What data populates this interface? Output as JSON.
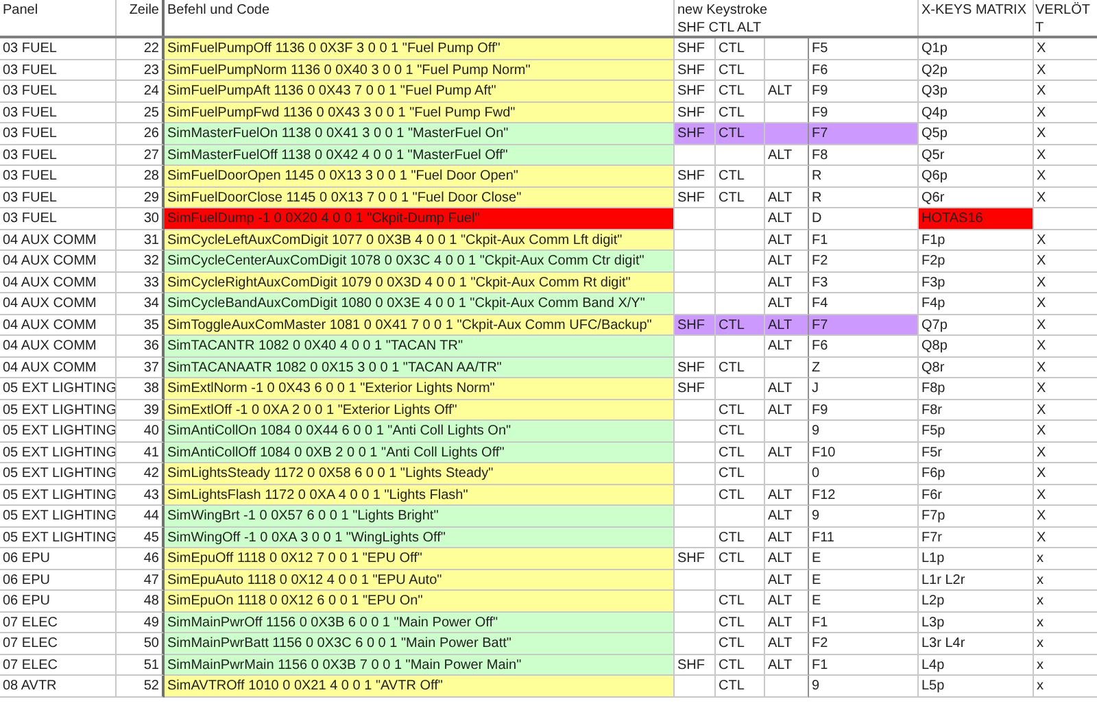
{
  "columns": {
    "panel": "Panel",
    "line": "Zeile",
    "code": "Befehl und Code",
    "keystroke": [
      "new Keystroke",
      "SHF CTL ALT"
    ],
    "matrix": "X-KEYS MATRIX",
    "soldered": [
      "VERLÖT",
      "T"
    ]
  },
  "rows": [
    {
      "panel": "03 FUEL",
      "line": "22",
      "code": "SimFuelPumpOff 1136 0 0X3F 3 0 0 1 \"Fuel Pump Off\"",
      "color": "#ffff99",
      "shf": "SHF",
      "ctl": "CTL",
      "key": "F5",
      "key_marked": false,
      "matrix": "Q1p",
      "matrix_marked": false,
      "soldered": "X"
    },
    {
      "panel": "03 FUEL",
      "line": "23",
      "code": "SimFuelPumpNorm 1136 0 0X40 3 0 0 1 \"Fuel Pump Norm\"",
      "color": "#ffff99",
      "shf": "SHF",
      "ctl": "CTL",
      "key": "F6",
      "key_marked": false,
      "matrix": "Q2p",
      "matrix_marked": false,
      "soldered": "X"
    },
    {
      "panel": "03 FUEL",
      "line": "24",
      "code": "SimFuelPumpAft 1136 0 0X43 7 0 0 1 \"Fuel Pump Aft\"",
      "color": "#ffff99",
      "shf": "SHF",
      "ctl": "CTL",
      "alt": "ALT",
      "key": "F9",
      "key_marked": false,
      "matrix": "Q3p",
      "matrix_marked": false,
      "soldered": "X"
    },
    {
      "panel": "03 FUEL",
      "line": "25",
      "code": "SimFuelPumpFwd 1136 0 0X43 3 0 0 1 \"Fuel Pump Fwd\"",
      "color": "#ffff99",
      "shf": "SHF",
      "ctl": "CTL",
      "key": "F9",
      "key_marked": false,
      "matrix": "Q4p",
      "matrix_marked": false,
      "soldered": "X"
    },
    {
      "panel": "03 FUEL",
      "line": "26",
      "code": "SimMasterFuelOn 1138 0 0X41 3 0 0 1 \"MasterFuel On\"",
      "color": "#ccffcc",
      "shf": "SHF",
      "ctl": "CTL",
      "key": "F7",
      "key_marked": true,
      "matrix": "Q5p",
      "matrix_marked": false,
      "soldered": "X"
    },
    {
      "panel": "03 FUEL",
      "line": "27",
      "code": "SimMasterFuelOff 1138 0 0X42 4 0 0 1 \"MasterFuel Off\"",
      "color": "#ccffcc",
      "alt": "ALT",
      "key": "F8",
      "key_marked": false,
      "matrix": "Q5r",
      "matrix_marked": false,
      "soldered": "X"
    },
    {
      "panel": "03 FUEL",
      "line": "28",
      "code": "SimFuelDoorOpen 1145 0 0X13 3 0 0 1 \"Fuel Door Open\"",
      "color": "#ffff99",
      "shf": "SHF",
      "ctl": "CTL",
      "key": "R",
      "key_marked": false,
      "matrix": "Q6p",
      "matrix_marked": false,
      "soldered": "X"
    },
    {
      "panel": "03 FUEL",
      "line": "29",
      "code": "SimFuelDoorClose 1145 0 0X13 7 0 0 1 \"Fuel Door Close\"",
      "color": "#ffff99",
      "shf": "SHF",
      "ctl": "CTL",
      "alt": "ALT",
      "key": "R",
      "key_marked": false,
      "matrix": "Q6r",
      "matrix_marked": false,
      "soldered": "X"
    },
    {
      "panel": "03 FUEL",
      "line": "30",
      "code": "SimFuelDump -1 0 0X20 4 0 0 1 \"Ckpit-Dump Fuel\"",
      "color": "#ff0000",
      "alt": "ALT",
      "key": "D",
      "key_marked": false,
      "matrix": "HOTAS16",
      "matrix_marked": true
    },
    {
      "panel": "04 AUX COMM",
      "line": "31",
      "code": "SimCycleLeftAuxComDigit 1077 0 0X3B 4 0 0 1 \"Ckpit-Aux Comm Lft digit\"",
      "color": "#ffff99",
      "alt": "ALT",
      "key": "F1",
      "key_marked": false,
      "matrix": "F1p",
      "matrix_marked": false,
      "soldered": "X"
    },
    {
      "panel": "04 AUX COMM",
      "line": "32",
      "code": "SimCycleCenterAuxComDigit 1078 0 0X3C 4 0 0 1 \"Ckpit-Aux Comm Ctr digit\"",
      "color": "#ccffcc",
      "alt": "ALT",
      "key": "F2",
      "key_marked": false,
      "matrix": "F2p",
      "matrix_marked": false,
      "soldered": "X"
    },
    {
      "panel": "04 AUX COMM",
      "line": "33",
      "code": "SimCycleRightAuxComDigit 1079 0 0X3D 4 0 0 1 \"Ckpit-Aux Comm Rt digit\"",
      "color": "#ffff99",
      "alt": "ALT",
      "key": "F3",
      "key_marked": false,
      "matrix": "F3p",
      "matrix_marked": false,
      "soldered": "X"
    },
    {
      "panel": "04 AUX COMM",
      "line": "34",
      "code": "SimCycleBandAuxComDigit 1080 0 0X3E 4 0 0 1 \"Ckpit-Aux Comm Band X/Y\"",
      "color": "#ccffcc",
      "alt": "ALT",
      "key": "F4",
      "key_marked": false,
      "matrix": "F4p",
      "matrix_marked": false,
      "soldered": "X"
    },
    {
      "panel": "04 AUX COMM",
      "line": "35",
      "code": "SimToggleAuxComMaster 1081 0 0X41 7 0 0 1 \"Ckpit-Aux Comm UFC/Backup\"",
      "color": "#ffff99",
      "shf": "SHF",
      "ctl": "CTL",
      "alt": "ALT",
      "key": "F7",
      "key_marked": true,
      "matrix": "Q7p",
      "matrix_marked": false,
      "soldered": "X"
    },
    {
      "panel": "04 AUX COMM",
      "line": "36",
      "code": "SimTACANTR 1082 0 0X40 4 0 0 1 \"TACAN TR\"",
      "color": "#ccffcc",
      "alt": "ALT",
      "key": "F6",
      "key_marked": false,
      "matrix": "Q8p",
      "matrix_marked": false,
      "soldered": "X"
    },
    {
      "panel": "04 AUX COMM",
      "line": "37",
      "code": "SimTACANAATR 1082 0 0X15 3 0 0 1 \"TACAN AA/TR\"",
      "color": "#ccffcc",
      "shf": "SHF",
      "ctl": "CTL",
      "key": "Z",
      "key_marked": false,
      "matrix": "Q8r",
      "matrix_marked": false,
      "soldered": "X"
    },
    {
      "panel": "05 EXT LIGHTING",
      "line": "38",
      "code": "SimExtlNorm -1 0 0X43 6 0 0 1 \"Exterior Lights Norm\"",
      "color": "#ffff99",
      "shf": "SHF",
      "alt": "ALT",
      "key": "J",
      "key_marked": false,
      "matrix": "F8p",
      "matrix_marked": false,
      "soldered": "X"
    },
    {
      "panel": "05 EXT LIGHTING",
      "line": "39",
      "code": "SimExtlOff -1 0 0XA 2 0 0 1 \"Exterior Lights Off\"",
      "color": "#ffff99",
      "ctl": "CTL",
      "alt": "ALT",
      "key": "F9",
      "key_marked": false,
      "matrix": "F8r",
      "matrix_marked": false,
      "soldered": "X"
    },
    {
      "panel": "05 EXT LIGHTING",
      "line": "40",
      "code": "SimAntiCollOn 1084 0 0X44 6 0 0 1 \"Anti Coll Lights On\"",
      "color": "#ccffcc",
      "ctl": "CTL",
      "key": "9",
      "key_marked": false,
      "matrix": "F5p",
      "matrix_marked": false,
      "soldered": "X"
    },
    {
      "panel": "05 EXT LIGHTING",
      "line": "41",
      "code": "SimAntiCollOff 1084 0 0XB 2 0 0 1 \"Anti Coll Lights Off\"",
      "color": "#ccffcc",
      "ctl": "CTL",
      "alt": "ALT",
      "key": "F10",
      "key_marked": false,
      "matrix": "F5r",
      "matrix_marked": false,
      "soldered": "X"
    },
    {
      "panel": "05 EXT LIGHTING",
      "line": "42",
      "code": "SimLightsSteady 1172 0 0X58 6 0 0 1 \"Lights Steady\"",
      "color": "#ffff99",
      "ctl": "CTL",
      "key": "0",
      "key_marked": false,
      "matrix": "F6p",
      "matrix_marked": false,
      "soldered": "X"
    },
    {
      "panel": "05 EXT LIGHTING",
      "line": "43",
      "code": "SimLightsFlash 1172 0 0XA 4 0 0 1 \"Lights Flash\"",
      "color": "#ffff99",
      "ctl": "CTL",
      "alt": "ALT",
      "key": "F12",
      "key_marked": false,
      "matrix": "F6r",
      "matrix_marked": false,
      "soldered": "X"
    },
    {
      "panel": "05 EXT LIGHTING",
      "line": "44",
      "code": "SimWingBrt -1 0 0X57 6 0 0 1 \"Lights Bright\"",
      "color": "#ccffcc",
      "alt": "ALT",
      "key": "9",
      "key_marked": false,
      "matrix": "F7p",
      "matrix_marked": false,
      "soldered": "X"
    },
    {
      "panel": "05 EXT LIGHTING",
      "line": "45",
      "code": "SimWingOff -1 0 0XA 3 0 0 1 \"WingLights Off\"",
      "color": "#ccffcc",
      "ctl": "CTL",
      "alt": "ALT",
      "key": "F11",
      "key_marked": false,
      "matrix": "F7r",
      "matrix_marked": false,
      "soldered": "X"
    },
    {
      "panel": "06 EPU",
      "line": "46",
      "code": "SimEpuOff 1118 0 0X12 7 0 0 1 \"EPU Off\"",
      "color": "#ffff99",
      "shf": "SHF",
      "ctl": "CTL",
      "alt": "ALT",
      "key": "E",
      "key_marked": false,
      "matrix": "L1p",
      "matrix_marked": false,
      "soldered": "x"
    },
    {
      "panel": "06 EPU",
      "line": "47",
      "code": "SimEpuAuto 1118 0 0X12 4 0 0 1 \"EPU Auto\"",
      "color": "#ffff99",
      "alt": "ALT",
      "key": "E",
      "key_marked": false,
      "matrix": "L1r L2r",
      "matrix_marked": false,
      "soldered": "x"
    },
    {
      "panel": "06 EPU",
      "line": "48",
      "code": "SimEpuOn 1118 0 0X12 6 0 0 1 \"EPU On\"",
      "color": "#ffff99",
      "ctl": "CTL",
      "alt": "ALT",
      "key": "E",
      "key_marked": false,
      "matrix": "L2p",
      "matrix_marked": false,
      "soldered": "x"
    },
    {
      "panel": "07 ELEC",
      "line": "49",
      "code": "SimMainPwrOff 1156 0 0X3B 6 0 0 1 \"Main Power Off\"",
      "color": "#ccffcc",
      "ctl": "CTL",
      "alt": "ALT",
      "key": "F1",
      "key_marked": false,
      "matrix": "L3p",
      "matrix_marked": false,
      "soldered": "x"
    },
    {
      "panel": "07 ELEC",
      "line": "50",
      "code": "SimMainPwrBatt 1156 0 0X3C 6 0 0 1 \"Main Power Batt\"",
      "color": "#ccffcc",
      "ctl": "CTL",
      "alt": "ALT",
      "key": "F2",
      "key_marked": false,
      "matrix": "L3r L4r",
      "matrix_marked": false,
      "soldered": "x"
    },
    {
      "panel": "07 ELEC",
      "line": "51",
      "code": "SimMainPwrMain 1156 0 0X3B 7 0 0 1 \"Main Power Main\"",
      "color": "#ccffcc",
      "shf": "SHF",
      "ctl": "CTL",
      "alt": "ALT",
      "key": "F1",
      "key_marked": false,
      "matrix": "L4p",
      "matrix_marked": false,
      "soldered": "x"
    },
    {
      "panel": "08 AVTR",
      "line": "52",
      "code": "SimAVTROff 1010 0 0X21 4 0 0 1 \"AVTR Off\"",
      "color": "#ffff99",
      "ctl": "CTL",
      "key": "9",
      "key_marked": false,
      "matrix": "L5p",
      "matrix_marked": false,
      "soldered": "x"
    }
  ]
}
